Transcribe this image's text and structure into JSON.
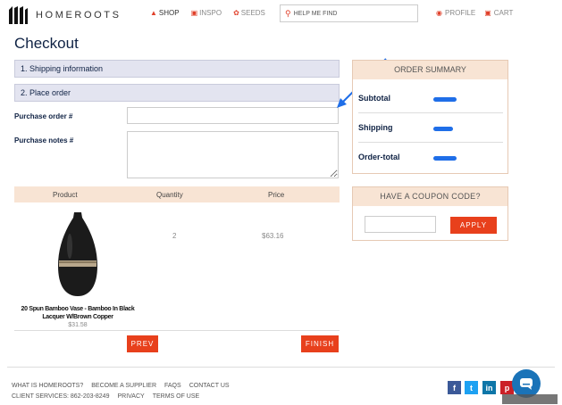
{
  "brand": {
    "name": "HOMEROOTS"
  },
  "nav": {
    "items": [
      {
        "label": "SHOP",
        "icon": "shop-bag-icon",
        "active": true
      },
      {
        "label": "INSPO",
        "icon": "image-icon",
        "active": false
      },
      {
        "label": "SEEDS",
        "icon": "leaf-icon",
        "active": false
      }
    ],
    "search_placeholder": "HELP ME FIND",
    "profile_label": "PROFILE",
    "cart_label": "CART"
  },
  "page_title": "Checkout",
  "steps": [
    "1. Shipping information",
    "2. Place order"
  ],
  "form": {
    "purchase_order_label": "Purchase order #",
    "purchase_order_value": "",
    "purchase_notes_label": "Purchase notes #",
    "purchase_notes_value": ""
  },
  "table": {
    "headers": [
      "Product",
      "Quantity",
      "Price"
    ],
    "rows": [
      {
        "name": "20 Spun Bamboo Vase - Bamboo In Black Lacquer W/Brown Copper",
        "unit_price": "$31.58",
        "quantity": "2",
        "line_price": "$63.16"
      }
    ]
  },
  "buttons": {
    "prev": "PREV",
    "finish": "FINISH",
    "apply": "APPLY"
  },
  "order_summary": {
    "title": "ORDER SUMMARY",
    "rows": [
      "Subtotal",
      "Shipping",
      "Order-total"
    ]
  },
  "coupon": {
    "title": "HAVE A COUPON CODE?",
    "value": ""
  },
  "footer": {
    "row1": [
      "WHAT IS HOMEROOTS?",
      "BECOME A SUPPLIER",
      "FAQS",
      "CONTACT US"
    ],
    "row2": [
      "CLIENT SERVICES: 862-203-8249",
      "PRIVACY",
      "TERMS OF USE"
    ],
    "social": [
      "f",
      "t",
      "in",
      "p"
    ]
  },
  "colors": {
    "accent": "#e8401c",
    "navy": "#0f2244",
    "step_bg": "#e3e4f0",
    "peach": "#f8e4d4",
    "annotation_blue": "#1f6ee8"
  }
}
